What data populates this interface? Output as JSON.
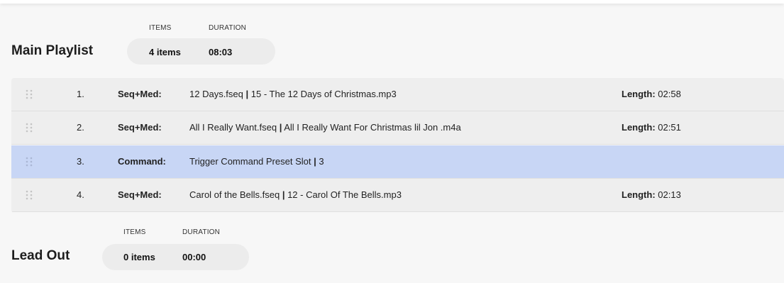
{
  "main_playlist": {
    "title": "Main Playlist",
    "items_label": "ITEMS",
    "duration_label": "DURATION",
    "items_value": "4 items",
    "duration_value": "08:03",
    "entries": [
      {
        "num": "1.",
        "type": "Seq+Med:",
        "desc_a": "12 Days.fseq",
        "sep": "|",
        "desc_b": "15 - The 12 Days of Christmas.mp3",
        "length_label": "Length:",
        "length_value": "02:58",
        "selected": false
      },
      {
        "num": "2.",
        "type": "Seq+Med:",
        "desc_a": "All I Really Want.fseq",
        "sep": "|",
        "desc_b": "All I Really Want For Christmas lil Jon .m4a",
        "length_label": "Length:",
        "length_value": "02:51",
        "selected": false
      },
      {
        "num": "3.",
        "type": "Command:",
        "desc_a": "Trigger Command Preset Slot",
        "sep": "|",
        "desc_b": "3",
        "length_label": "",
        "length_value": "",
        "selected": true
      },
      {
        "num": "4.",
        "type": "Seq+Med:",
        "desc_a": "Carol of the Bells.fseq",
        "sep": "|",
        "desc_b": "12 - Carol Of The Bells.mp3",
        "length_label": "Length:",
        "length_value": "02:13",
        "selected": false
      }
    ]
  },
  "lead_out": {
    "title": "Lead Out",
    "items_label": "ITEMS",
    "duration_label": "DURATION",
    "items_value": "0 items",
    "duration_value": "00:00"
  },
  "colors": {
    "row_background": "#eeeeee",
    "row_selected": "#c8d6f5",
    "pill_background": "#ececec",
    "page_background": "#f7f7f7"
  },
  "icons": {
    "drag_handle": "drag-handle-icon"
  }
}
